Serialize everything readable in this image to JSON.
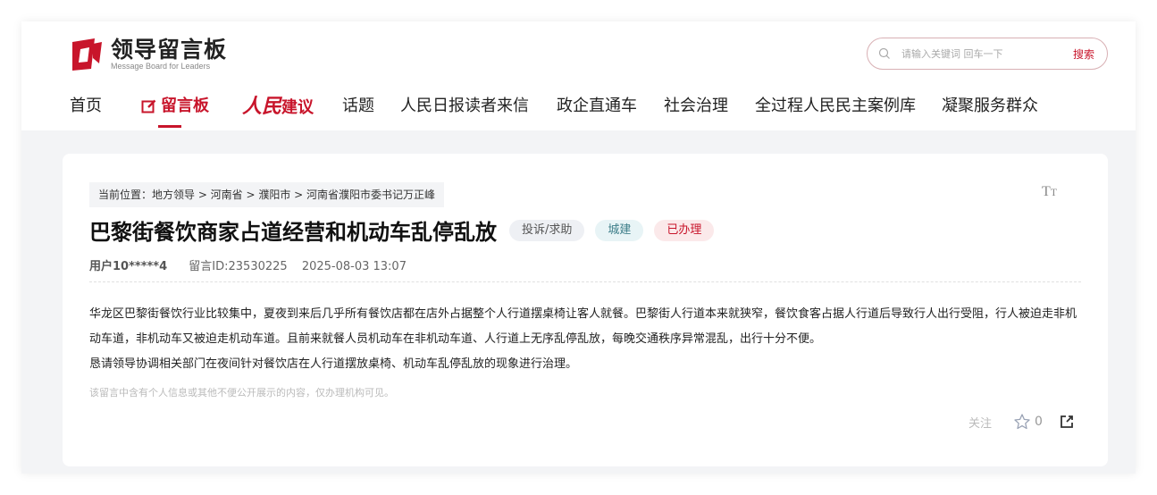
{
  "header": {
    "logo_title": "领导留言板",
    "logo_subtitle": "Message Board for Leaders",
    "search_placeholder": "请输入关键词 回车一下",
    "search_button": "搜索"
  },
  "nav": {
    "items": [
      {
        "label": "首页"
      },
      {
        "label": "留言板",
        "active": true
      },
      {
        "label_a": "人民",
        "label_b": "建议"
      },
      {
        "label": "话题"
      },
      {
        "label": "人民日报读者来信"
      },
      {
        "label": "政企直通车"
      },
      {
        "label": "社会治理"
      },
      {
        "label": "全过程人民民主案例库"
      },
      {
        "label": "凝聚服务群众"
      }
    ]
  },
  "message": {
    "breadcrumb": "当前位置：地方领导 > 河南省 > 濮阳市 > 河南省濮阳市委书记万正峰",
    "font_toggle": "TT",
    "title": "巴黎街餐饮商家占道经营和机动车乱停乱放",
    "tags": [
      "投诉/求助",
      "城建",
      "已办理"
    ],
    "user": "用户10*****4",
    "message_id": "留言ID:23530225",
    "datetime": "2025-08-03 13:07",
    "content_p1": "华龙区巴黎街餐饮行业比较集中，夏夜到来后几乎所有餐饮店都在店外占据整个人行道摆桌椅让客人就餐。巴黎街人行道本来就狭窄，餐饮食客占据人行道后导致行人出行受阻，行人被迫走非机动车道，非机动车又被迫走机动车道。且前来就餐人员机动车在非机动车道、人行道上无序乱停乱放，每晚交通秩序异常混乱，出行十分不便。",
    "content_p2": "恳请领导协调相关部门在夜间针对餐饮店在人行道摆放桌椅、机动车乱停乱放的现象进行治理。",
    "privacy_notice": "该留言中含有个人信息或其他不便公开展示的内容，仅办理机构可见。",
    "follow_label": "关注",
    "star_count": "0"
  },
  "colors": {
    "brand_red": "#c8152b",
    "tag_gray_bg": "#eef0f4",
    "tag_teal_bg": "#e8f4f6",
    "tag_red_bg": "#fbe9ea"
  }
}
